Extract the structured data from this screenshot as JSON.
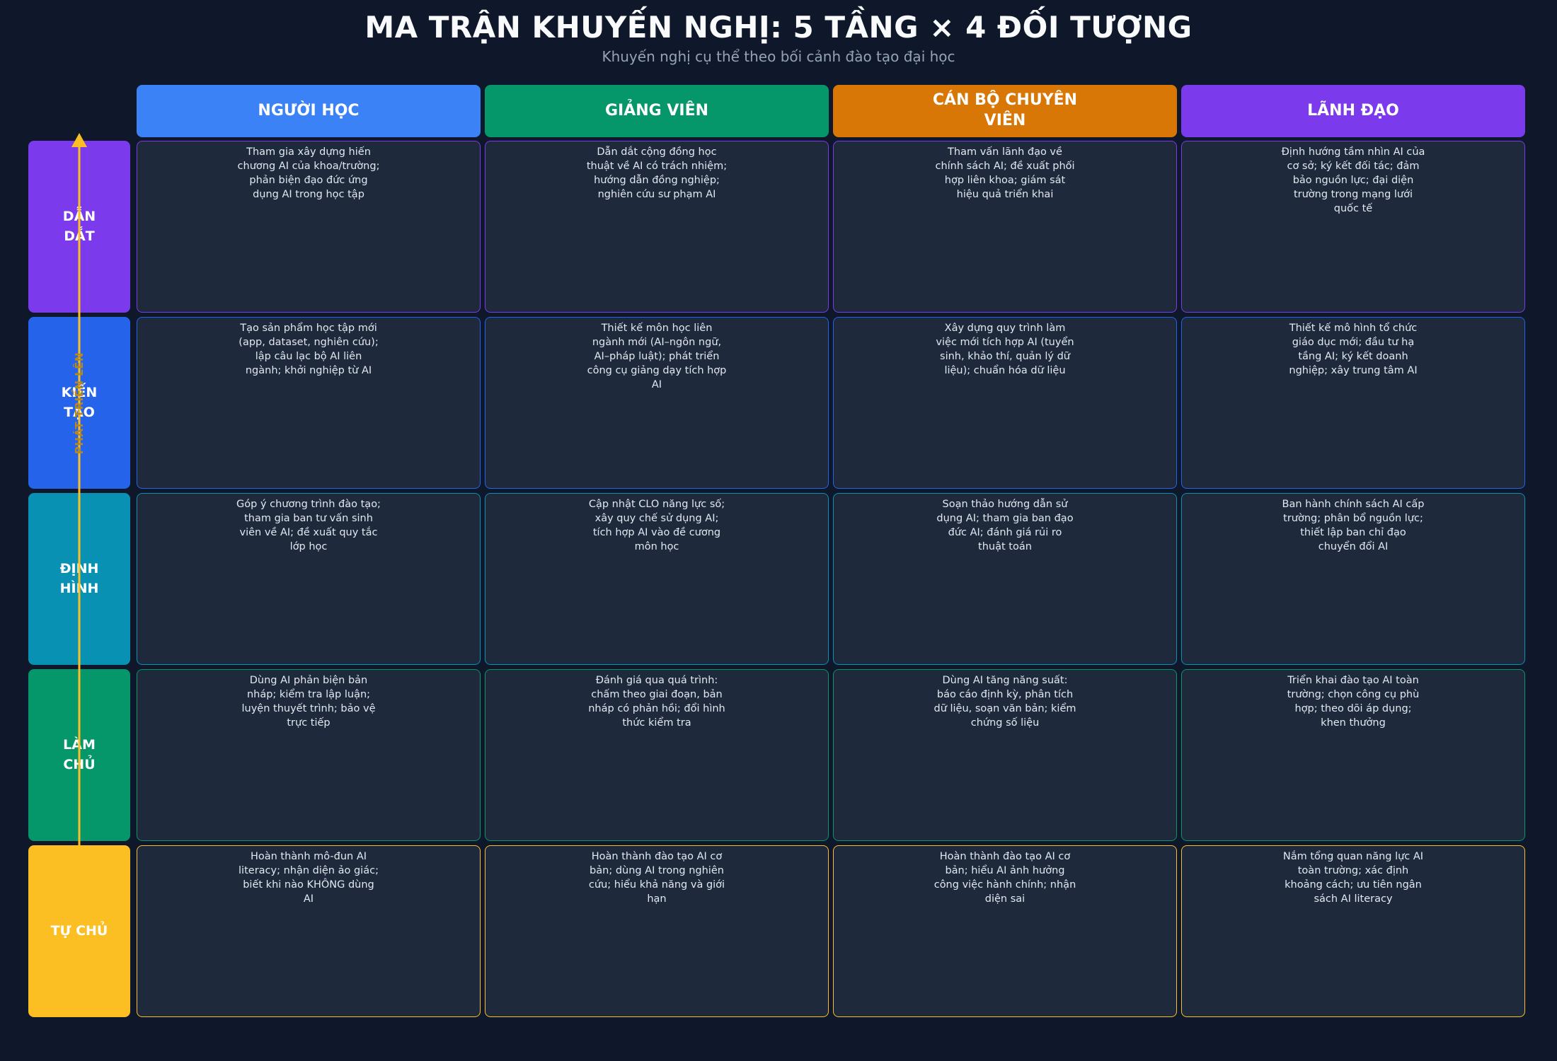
{
  "header": {
    "title": "MA TRẬN KHUYẾN NGHỊ: 5 TẦNG × 4 ĐỐI TƯỢNG",
    "subtitle": "Khuyến nghị cụ thể theo bối cảnh đào tạo đại học"
  },
  "columns": [
    {
      "label": "NGƯỜI HỌC",
      "color": "#3b82f6"
    },
    {
      "label": "GIẢNG VIÊN",
      "color": "#059669"
    },
    {
      "label": "CÁN BỘ CHUYÊN VIÊN",
      "color": "#d97706"
    },
    {
      "label": "LÃNH ĐẠO",
      "color": "#7c3aed"
    }
  ],
  "arrow": {
    "label": "PHÁT TRIỂN LÊN",
    "color": "#fbbf24"
  },
  "rows": [
    {
      "label": "DẪN DẮT",
      "color": "#7c3aed",
      "cells": [
        "Tham gia xây dựng hiến chương AI của khoa/trường; phản biện đạo đức ứng dụng AI trong học tập",
        "Dẫn dắt cộng đồng học thuật về AI có trách nhiệm; hướng dẫn đồng nghiệp; nghiên cứu sư phạm AI",
        "Tham vấn lãnh đạo về chính sách AI; đề xuất phối hợp liên khoa; giám sát hiệu quả triển khai",
        "Định hướng tầm nhìn AI của cơ sở; ký kết đối tác; đảm bảo nguồn lực; đại diện trường trong mạng lưới quốc tế"
      ]
    },
    {
      "label": "KIẾN TẠO",
      "color": "#2563eb",
      "cells": [
        "Tạo sản phẩm học tập mới (app, dataset, nghiên cứu); lập câu lạc bộ AI liên ngành; khởi nghiệp từ AI",
        "Thiết kế môn học liên ngành mới (AI–ngôn ngữ, AI–pháp luật); phát triển công cụ giảng dạy tích hợp AI",
        "Xây dựng quy trình làm việc mới tích hợp AI (tuyển sinh, khảo thí, quản lý dữ liệu); chuẩn hóa dữ liệu",
        "Thiết kế mô hình tổ chức giáo dục mới; đầu tư hạ tầng AI; ký kết doanh nghiệp; xây trung tâm AI"
      ]
    },
    {
      "label": "ĐỊNH HÌNH",
      "color": "#0891b2",
      "cells": [
        "Góp ý chương trình đào tạo; tham gia ban tư vấn sinh viên về AI; đề xuất quy tắc lớp học",
        "Cập nhật CLO năng lực số; xây quy chế sử dụng AI; tích hợp AI vào đề cương môn học",
        "Soạn thảo hướng dẫn sử dụng AI; tham gia ban đạo đức AI; đánh giá rủi ro thuật toán",
        "Ban hành chính sách AI cấp trường; phân bổ nguồn lực; thiết lập ban chỉ đạo chuyển đổi AI"
      ]
    },
    {
      "label": "LÀM CHỦ",
      "color": "#059669",
      "cells": [
        "Dùng AI phản biện bản nháp; kiểm tra lập luận; luyện thuyết trình; bảo vệ trực tiếp",
        "Đánh giá qua quá trình: chấm theo giai đoạn, bản nháp có phản hồi; đổi hình thức kiểm tra",
        "Dùng AI tăng năng suất: báo cáo định kỳ, phân tích dữ liệu, soạn văn bản; kiểm chứng số liệu",
        "Triển khai đào tạo AI toàn trường; chọn công cụ phù hợp; theo dõi áp dụng; khen thưởng"
      ]
    },
    {
      "label": "TỰ CHỦ",
      "color": "#fbbf24",
      "cells": [
        "Hoàn thành mô-đun AI literacy; nhận diện ảo giác; biết khi nào KHÔNG dùng AI",
        "Hoàn thành đào tạo AI cơ bản; dùng AI trong nghiên cứu; hiểu khả năng và giới hạn",
        "Hoàn thành đào tạo AI cơ bản; hiểu AI ảnh hưởng công việc hành chính; nhận diện sai",
        "Nắm tổng quan năng lực AI toàn trường; xác định khoảng cách; ưu tiên ngân sách AI literacy"
      ]
    }
  ]
}
